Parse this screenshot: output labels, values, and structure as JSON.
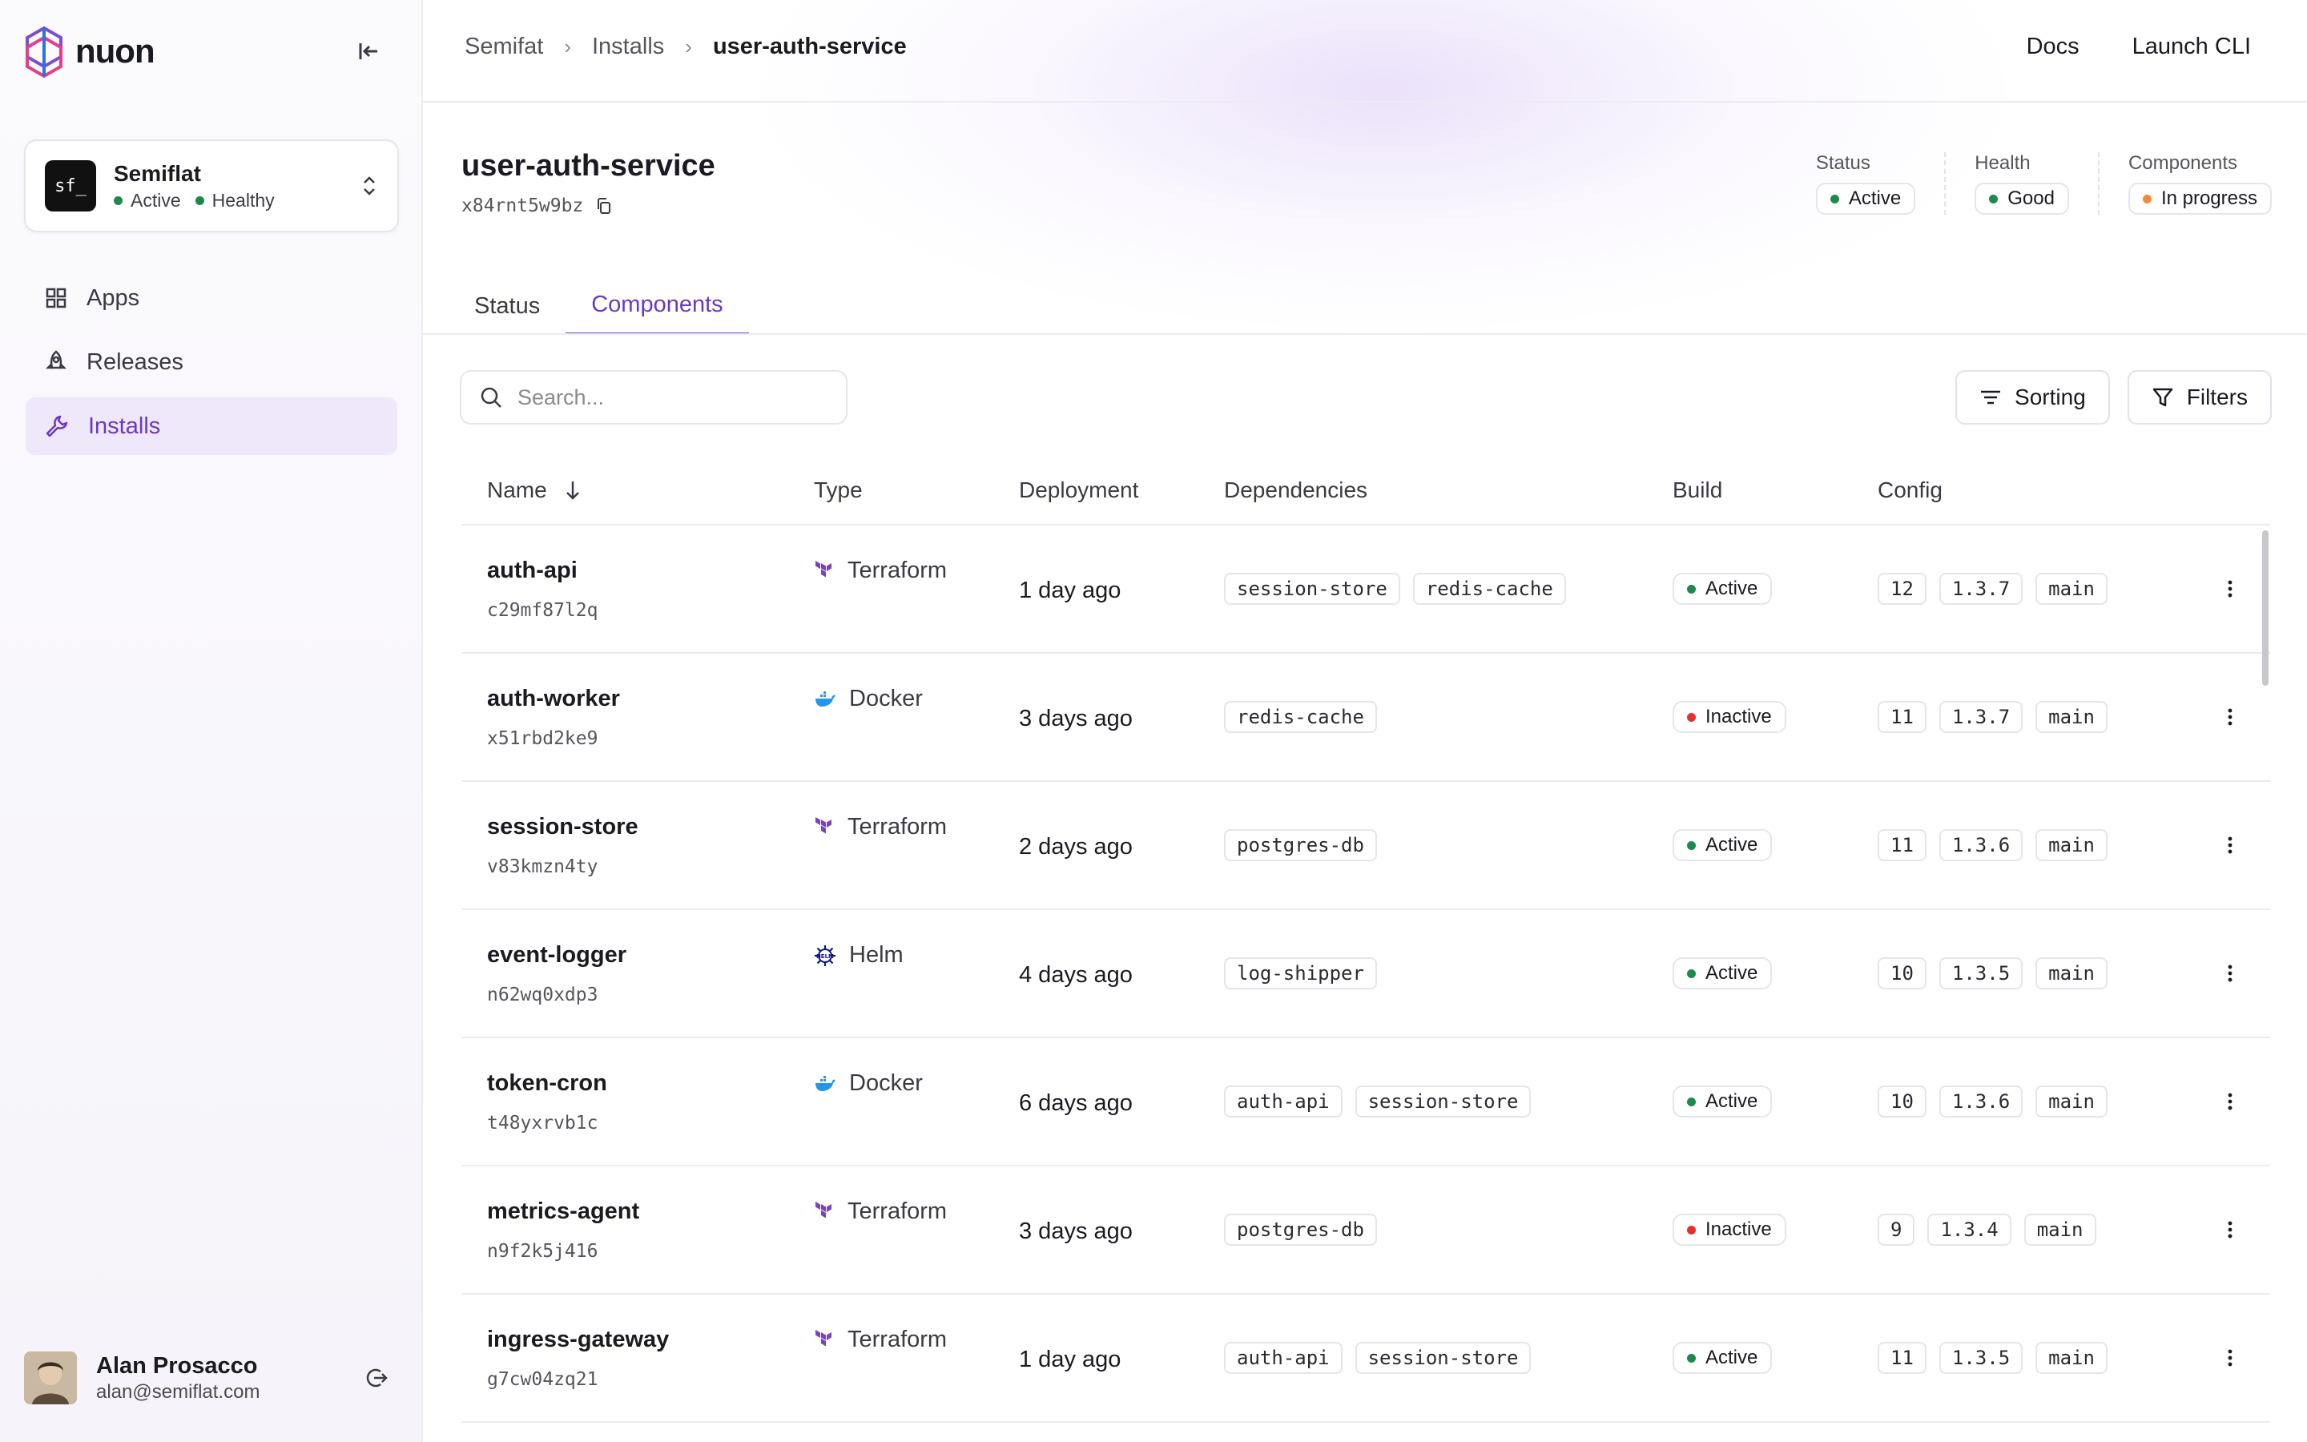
{
  "brand": {
    "name": "nuon"
  },
  "org": {
    "name": "Semiflat",
    "avatar_text": "sf_",
    "status": "Active",
    "health": "Healthy"
  },
  "nav": [
    {
      "label": "Apps",
      "icon": "grid-icon"
    },
    {
      "label": "Releases",
      "icon": "rocket-icon"
    },
    {
      "label": "Installs",
      "icon": "wrench-icon"
    }
  ],
  "user": {
    "name": "Alan Prosacco",
    "email": "alan@semiflat.com"
  },
  "breadcrumb": [
    "Semifat",
    "Installs",
    "user-auth-service"
  ],
  "top_links": {
    "docs": "Docs",
    "cli": "Launch CLI"
  },
  "install": {
    "title": "user-auth-service",
    "id": "x84rnt5w9bz"
  },
  "meta": {
    "status_label": "Status",
    "status_value": "Active",
    "health_label": "Health",
    "health_value": "Good",
    "components_label": "Components",
    "components_value": "In progress"
  },
  "tabs": [
    "Status",
    "Components"
  ],
  "search": {
    "placeholder": "Search..."
  },
  "toolbar": {
    "sorting": "Sorting",
    "filters": "Filters"
  },
  "columns": [
    "Name",
    "Type",
    "Deployment",
    "Dependencies",
    "Build",
    "Config"
  ],
  "rows": [
    {
      "name": "auth-api",
      "id": "c29mf87l2q",
      "type": "Terraform",
      "deployed": "1 day ago",
      "deps": [
        "session-store",
        "redis-cache"
      ],
      "build": "Active",
      "config": [
        "12",
        "1.3.7",
        "main"
      ]
    },
    {
      "name": "auth-worker",
      "id": "x51rbd2ke9",
      "type": "Docker",
      "deployed": "3 days ago",
      "deps": [
        "redis-cache"
      ],
      "build": "Inactive",
      "config": [
        "11",
        "1.3.7",
        "main"
      ]
    },
    {
      "name": "session-store",
      "id": "v83kmzn4ty",
      "type": "Terraform",
      "deployed": "2 days ago",
      "deps": [
        "postgres-db"
      ],
      "build": "Active",
      "config": [
        "11",
        "1.3.6",
        "main"
      ]
    },
    {
      "name": "event-logger",
      "id": "n62wq0xdp3",
      "type": "Helm",
      "deployed": "4 days ago",
      "deps": [
        "log-shipper"
      ],
      "build": "Active",
      "config": [
        "10",
        "1.3.5",
        "main"
      ]
    },
    {
      "name": "token-cron",
      "id": "t48yxrvb1c",
      "type": "Docker",
      "deployed": "6 days ago",
      "deps": [
        "auth-api",
        "session-store"
      ],
      "build": "Active",
      "config": [
        "10",
        "1.3.6",
        "main"
      ]
    },
    {
      "name": "metrics-agent",
      "id": "n9f2k5j416",
      "type": "Terraform",
      "deployed": "3 days ago",
      "deps": [
        "postgres-db"
      ],
      "build": "Inactive",
      "config": [
        "9",
        "1.3.4",
        "main"
      ]
    },
    {
      "name": "ingress-gateway",
      "id": "g7cw04zq21",
      "type": "Terraform",
      "deployed": "1 day ago",
      "deps": [
        "auth-api",
        "session-store"
      ],
      "build": "Active",
      "config": [
        "11",
        "1.3.5",
        "main"
      ]
    }
  ],
  "colors": {
    "accent": "#6a39c1",
    "active": "#1b8a4c",
    "inactive": "#e5322d",
    "progress": "#f58a3a"
  }
}
